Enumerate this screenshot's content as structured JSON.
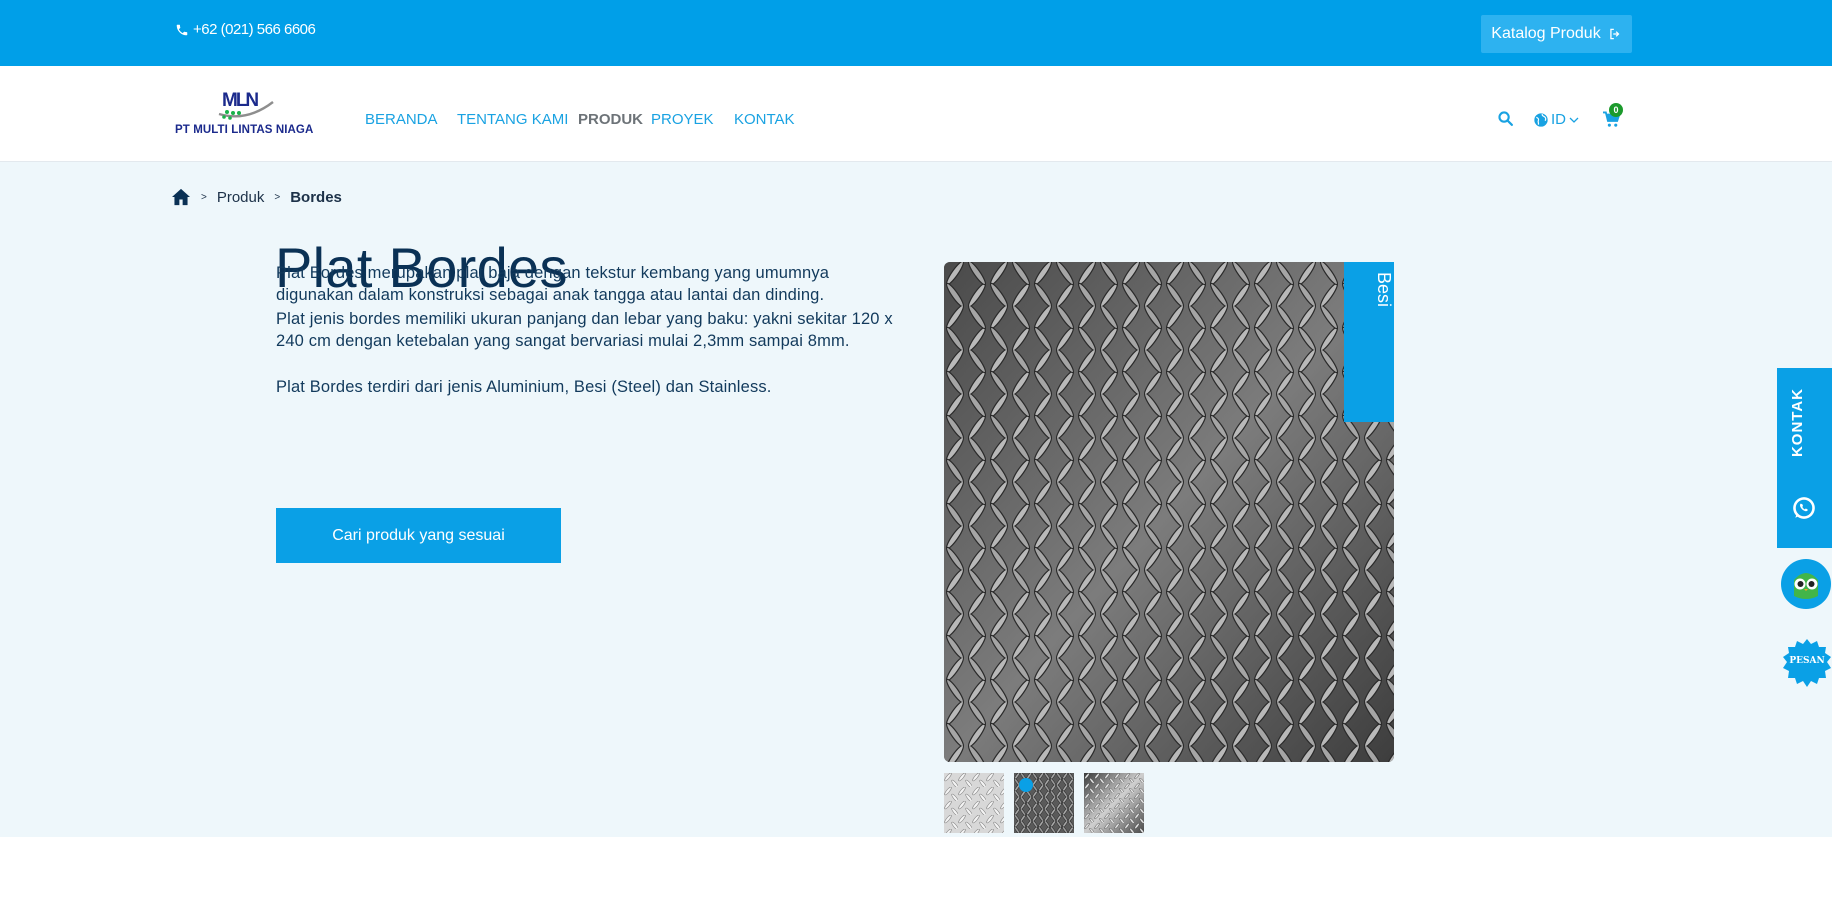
{
  "topbar": {
    "phone": "+62 (021) 566 6606",
    "catalog_label": "Katalog Produk"
  },
  "logo": {
    "mark_text": "MLN",
    "company_name": "PT MULTI LINTAS NIAGA"
  },
  "nav": {
    "items": [
      {
        "label": "BERANDA"
      },
      {
        "label": "TENTANG KAMI"
      },
      {
        "label": "PRODUK",
        "active": true
      },
      {
        "label": "PROYEK"
      },
      {
        "label": "KONTAK"
      }
    ],
    "language": "ID",
    "cart_count": "0"
  },
  "breadcrumb": {
    "items": [
      "Produk",
      "Bordes"
    ],
    "separator": ">"
  },
  "product": {
    "title": "Plat Bordes",
    "paragraphs": [
      "Plat Bordes merupakan plat baja dengan tekstur kembang yang umumnya digunakan dalam konstruksi sebagai anak tangga atau lantai dan dinding.",
      "Plat jenis bordes memiliki ukuran panjang dan lebar yang baku: yakni sekitar 120 x 240 cm dengan ketebalan yang sangat bervariasi mulai 2,3mm sampai 8mm.",
      "Plat Bordes terdiri dari jenis Aluminium, Besi (Steel) dan Stainless."
    ],
    "cta_label": "Cari produk yang sesuai",
    "tag": "Besi",
    "thumbnails": [
      "aluminium",
      "besi",
      "stainless"
    ],
    "selected_thumbnail": 1
  },
  "floating": {
    "contact_label": "KONTAK",
    "pesan_label": "PESAN"
  },
  "colors": {
    "primary": "#009fe8",
    "heading": "#0a3155",
    "background": "#eef7fb",
    "badge": "#1b9a2c"
  }
}
